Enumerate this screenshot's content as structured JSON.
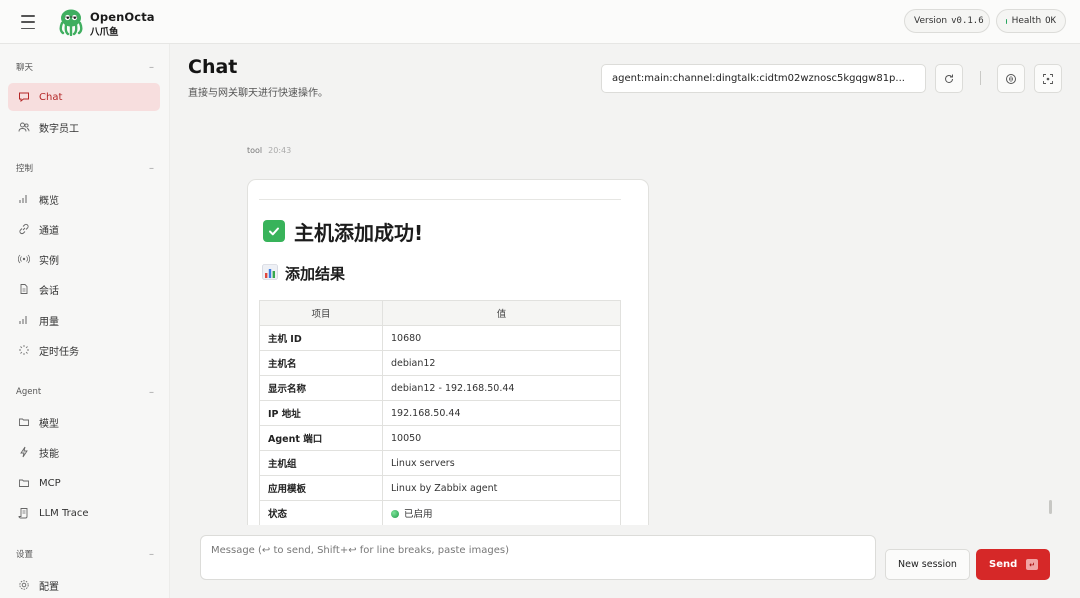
{
  "app": {
    "name": "OpenOcta",
    "subname": "八爪鱼"
  },
  "topbar": {
    "version_label": "Version",
    "version_value": "v0.1.6",
    "health_label": "Health",
    "health_value": "OK",
    "health_color": "#22a35a"
  },
  "sidebar": {
    "sections": [
      {
        "title": "聊天",
        "items": [
          {
            "label": "Chat",
            "icon": "message-icon",
            "active": true
          },
          {
            "label": "数字员工",
            "icon": "users-icon"
          }
        ]
      },
      {
        "title": "控制",
        "items": [
          {
            "label": "概览",
            "icon": "bar-chart-icon"
          },
          {
            "label": "通道",
            "icon": "link-icon"
          },
          {
            "label": "实例",
            "icon": "broadcast-icon"
          },
          {
            "label": "会话",
            "icon": "document-icon"
          },
          {
            "label": "用量",
            "icon": "bar-chart-icon"
          },
          {
            "label": "定时任务",
            "icon": "loader-icon"
          }
        ]
      },
      {
        "title": "Agent",
        "items": [
          {
            "label": "模型",
            "icon": "folder-icon"
          },
          {
            "label": "技能",
            "icon": "bolt-icon"
          },
          {
            "label": "MCP",
            "icon": "folder-icon"
          },
          {
            "label": "LLM Trace",
            "icon": "scroll-icon"
          }
        ]
      },
      {
        "title": "设置",
        "items": [
          {
            "label": "配置",
            "icon": "gear-icon"
          }
        ]
      }
    ]
  },
  "header": {
    "title": "Chat",
    "subtitle": "直接与网关聊天进行快速操作。",
    "session_key": "agent:main:channel:dingtalk:cidtm02wznosc5kgqgw81p..."
  },
  "message": {
    "sender": "tool",
    "time": "20:43",
    "heading": "主机添加成功!",
    "subheading": "添加结果",
    "table_headers": [
      "项目",
      "值"
    ],
    "rows": [
      [
        "主机 ID",
        "10680"
      ],
      [
        "主机名",
        "debian12"
      ],
      [
        "显示名称",
        "debian12 - 192.168.50.44"
      ],
      [
        "IP 地址",
        "192.168.50.44"
      ],
      [
        "Agent 端口",
        "10050"
      ],
      [
        "主机组",
        "Linux servers"
      ],
      [
        "应用模板",
        "Linux by Zabbix agent"
      ],
      [
        "状态",
        "已启用"
      ]
    ]
  },
  "composer": {
    "placeholder": "Message (↩ to send, Shift+↩ for line breaks, paste images)",
    "new_session_label": "New session",
    "send_label": "Send"
  },
  "colors": {
    "accent": "#d62828",
    "active_nav_bg": "#f7dede",
    "active_nav_text": "#b42626"
  }
}
